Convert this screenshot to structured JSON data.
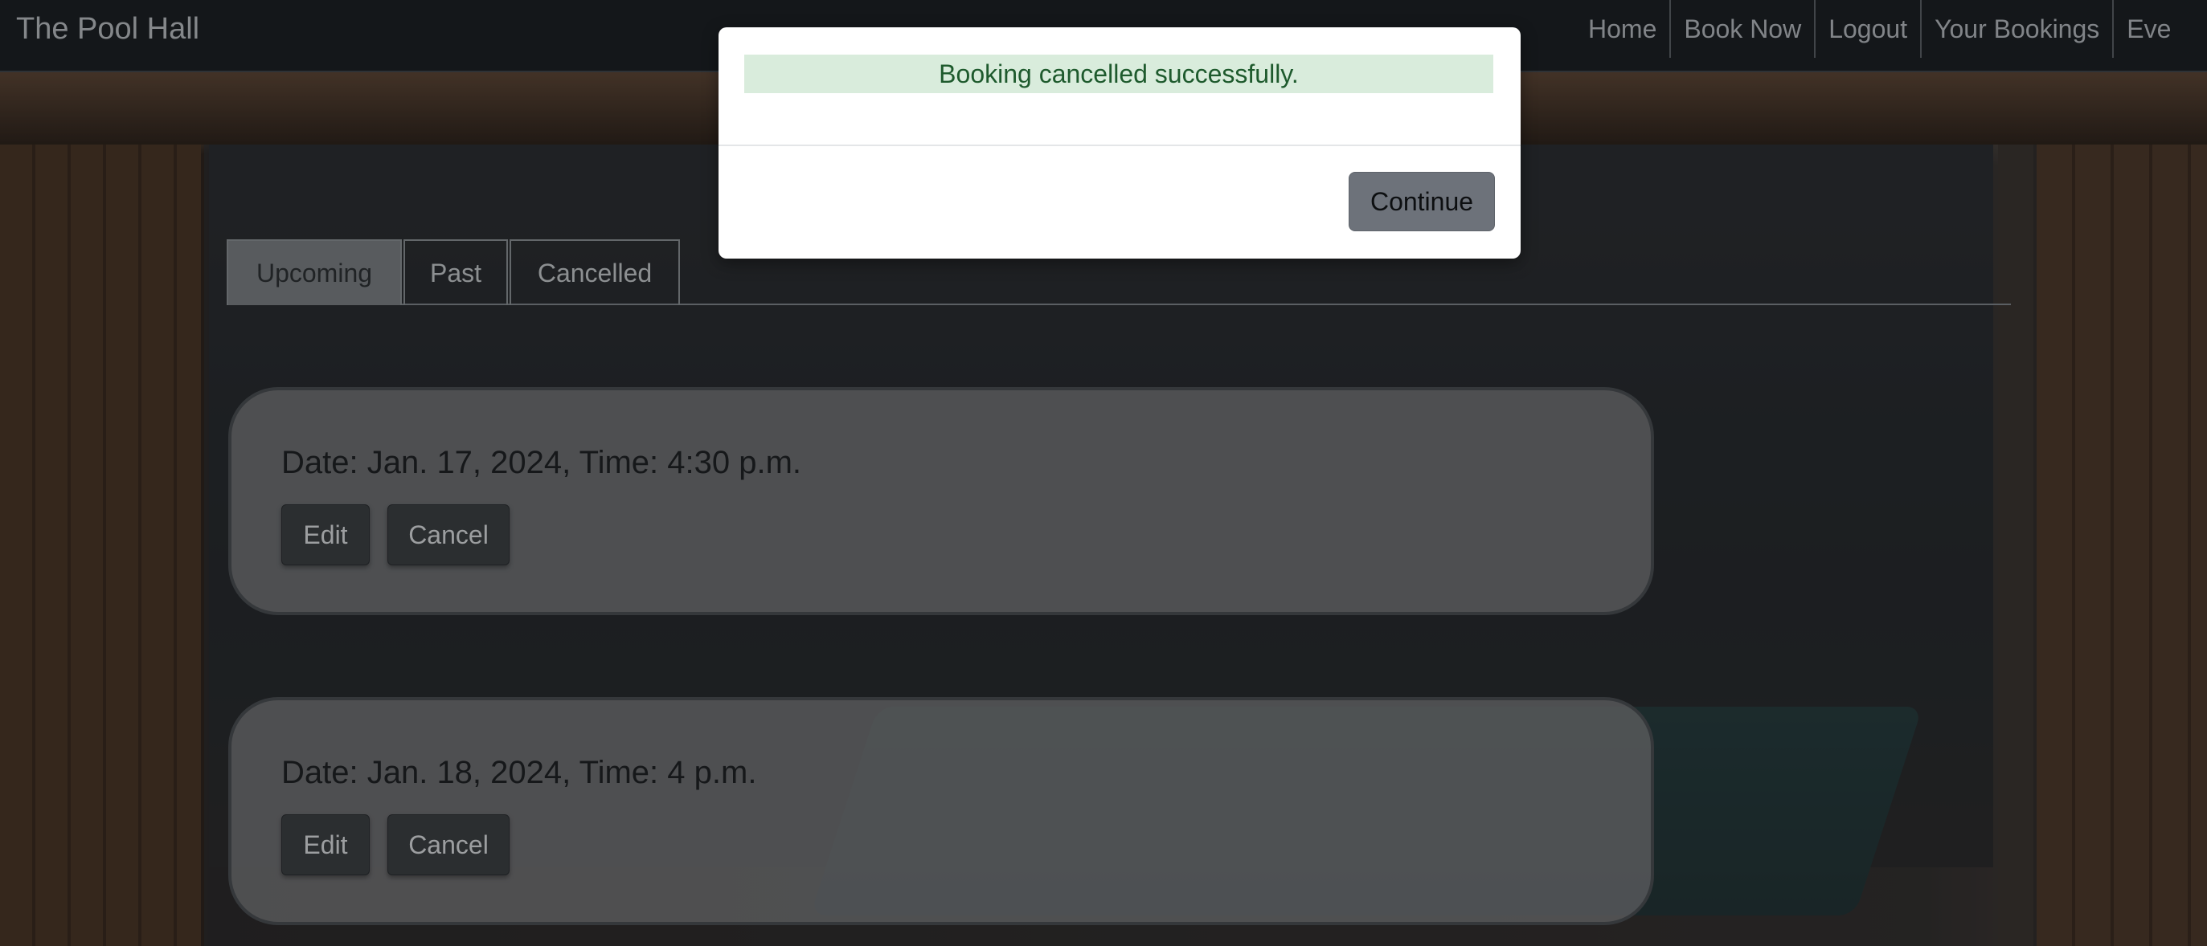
{
  "navbar": {
    "brand": "The Pool Hall",
    "links": [
      "Home",
      "Book Now",
      "Logout",
      "Your Bookings",
      "Eve"
    ]
  },
  "tabs": {
    "items": [
      "Upcoming",
      "Past",
      "Cancelled"
    ],
    "active": "Upcoming"
  },
  "bookings": [
    {
      "title": "Date: Jan. 17, 2024, Time: 4:30 p.m.",
      "edit_label": "Edit",
      "cancel_label": "Cancel"
    },
    {
      "title": "Date: Jan. 18, 2024, Time: 4 p.m.",
      "edit_label": "Edit",
      "cancel_label": "Cancel"
    }
  ],
  "modal": {
    "message": "Booking cancelled successfully.",
    "continue_label": "Continue"
  },
  "colors": {
    "navbar_bg": "#1c2125",
    "alert_bg": "#d9ecdc",
    "alert_text": "#1e5a2d",
    "button_secondary": "#6d727a"
  }
}
